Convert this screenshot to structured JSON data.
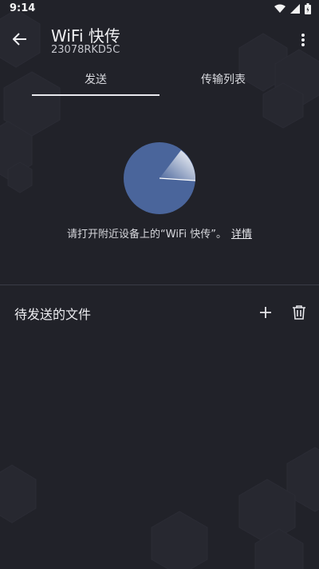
{
  "status_bar": {
    "time": "9:14",
    "icons": [
      "wifi-icon",
      "signal-icon",
      "battery-icon"
    ]
  },
  "app_bar": {
    "title": "WiFi 快传",
    "subtitle": "23078RKD5C",
    "back_icon": "arrow-back-icon",
    "menu_icon": "more-vert-icon"
  },
  "tabs": [
    {
      "label": "发送",
      "selected": true
    },
    {
      "label": "传输列表",
      "selected": false
    }
  ],
  "hint": {
    "text": "请打开附近设备上的“WiFi 快传”。",
    "link": "详情"
  },
  "pending_section": {
    "title": "待发送的文件",
    "add_icon": "plus-icon",
    "delete_icon": "trash-icon"
  },
  "colors": {
    "background": "#212229",
    "radar": "#4a659b",
    "accent_text": "#e9e9ee"
  }
}
